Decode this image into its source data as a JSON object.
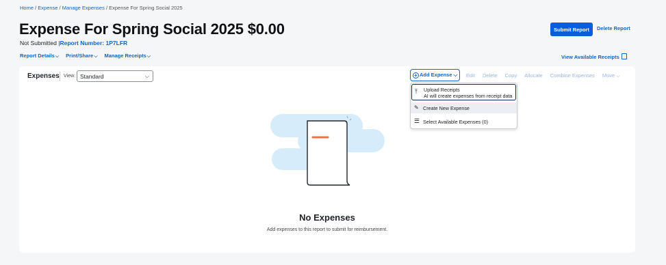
{
  "breadcrumb": {
    "items": [
      "Home",
      "Expense",
      "Manage Expenses"
    ],
    "separator": " / ",
    "current": "Expense For Spring Social 2025"
  },
  "report": {
    "title": "Expense For Spring Social 2025 $0.00",
    "status": "Not Submitted",
    "status_sep": " |",
    "number_label": "Report Number: 1P7LFR"
  },
  "subnav": {
    "report_details": "Report Details",
    "print_share": "Print/Share",
    "manage_receipts": "Manage Receipts"
  },
  "header_actions": {
    "submit": "Submit Report",
    "delete": "Delete Report",
    "view_receipts": "View Available Receipts"
  },
  "expenses_panel": {
    "title": "Expenses",
    "view_label": "View:",
    "view_value": "Standard",
    "add_expense": "Add Expense",
    "actions": [
      "Edit",
      "Delete",
      "Copy",
      "Allocate",
      "Combine Expenses",
      "Move"
    ],
    "dropdown": {
      "upload_title": "Upload Receipts",
      "upload_sub": "AI will create expenses from receipt data",
      "create_new": "Create New Expense",
      "select_available": "Select Available Expenses (0)"
    },
    "empty_title": "No Expenses",
    "empty_sub": "Add expenses to this report to submit for reimbursement."
  },
  "colors": {
    "link": "#1264c9",
    "primary_button": "#0b5ed7",
    "illustration_cloud": "#d6ecfb",
    "illustration_accent": "#f0704a"
  }
}
